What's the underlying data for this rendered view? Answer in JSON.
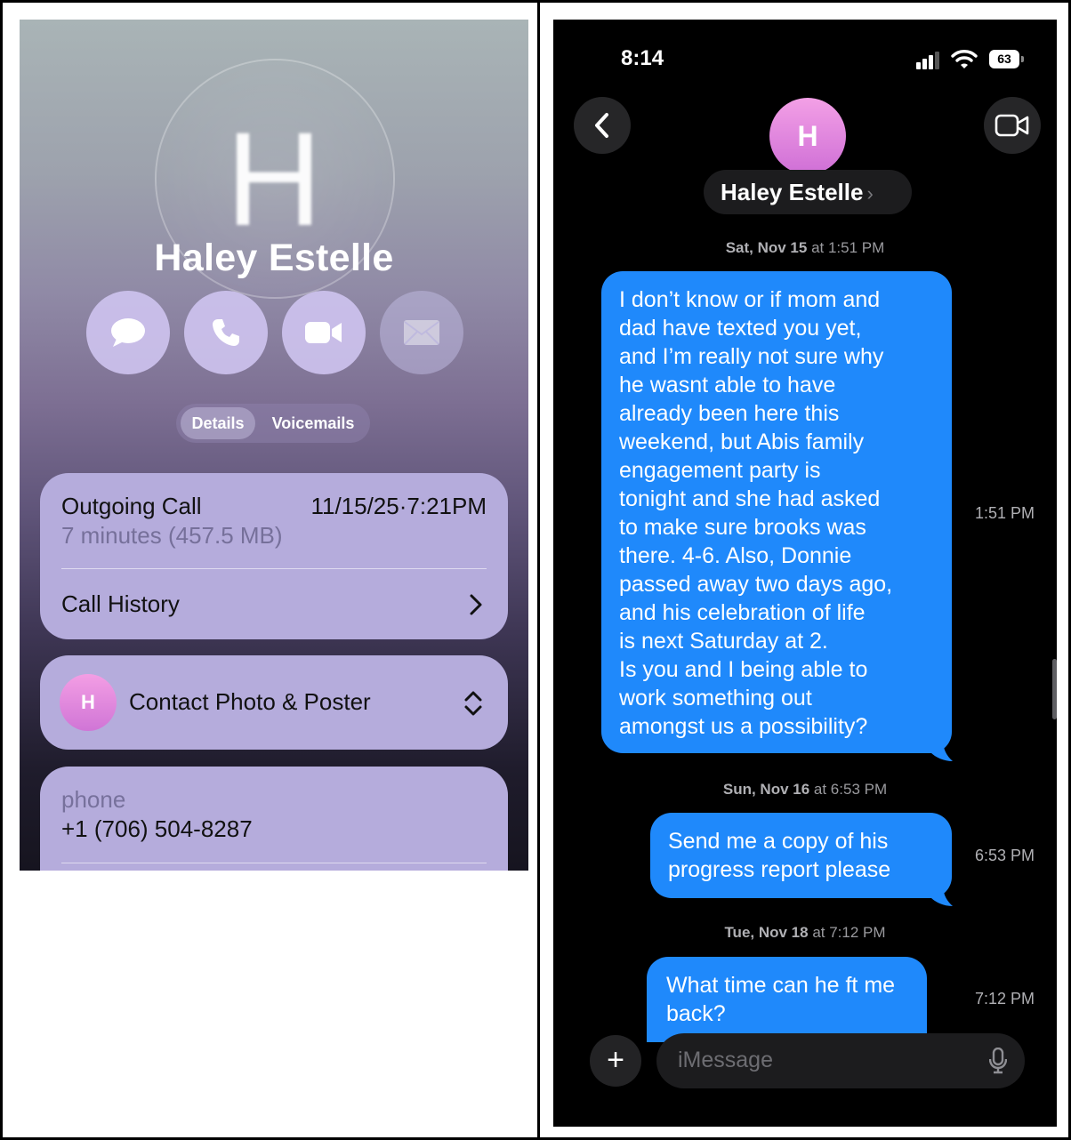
{
  "left_panel": {
    "initial": "H",
    "name": "Haley Estelle",
    "actions": [
      {
        "name": "message",
        "icon": "message-bubble-icon"
      },
      {
        "name": "call",
        "icon": "phone-icon"
      },
      {
        "name": "video",
        "icon": "video-camera-icon"
      },
      {
        "name": "mail",
        "icon": "mail-icon",
        "disabled": true
      }
    ],
    "tabs": {
      "details": "Details",
      "voicemails": "Voicemails"
    },
    "call_card": {
      "title": "Outgoing Call",
      "datetime": "11/15/25·7:21PM",
      "detail": "7 minutes (457.5 MB)",
      "history_label": "Call History"
    },
    "poster_card": {
      "avatar_initial": "H",
      "label": "Contact Photo & Poster"
    },
    "phone_card": {
      "label": "phone",
      "number": "+1 (706) 504-8287"
    }
  },
  "right_panel": {
    "status_bar": {
      "time": "8:14",
      "battery": "63"
    },
    "contact": {
      "initial": "H",
      "name": "Haley Estelle",
      "chevron": "›"
    },
    "messages": [
      {
        "stamp_day": "Sat, Nov 15",
        "stamp_time": "at 1:51 PM",
        "text": "I don’t know or if mom and\ndad have texted you yet,\nand I’m really not sure why\nhe wasnt able to have\nalready been here this\nweekend, but Abis family\nengagement party is\ntonight and she had asked\nto make sure brooks was\nthere. 4-6. Also, Donnie\npassed away two days ago,\nand his celebration of life\nis next Saturday at 2.\nIs you and I being able to\nwork something out\namongst us a possibility?",
        "time": "1:51 PM"
      },
      {
        "stamp_day": "Sun, Nov 16",
        "stamp_time": "at 6:53 PM",
        "text": "Send me a copy of his\nprogress report please",
        "time": "6:53 PM"
      },
      {
        "stamp_day": "Tue, Nov 18",
        "stamp_time": "at 7:12 PM",
        "text": "What time can he ft me\nback?",
        "time": "7:12 PM"
      }
    ],
    "composer": {
      "plus": "+",
      "placeholder": "iMessage"
    },
    "colors": {
      "bubble": "#1f89fb",
      "background": "#000000",
      "avatar": "#e08ae0"
    }
  }
}
